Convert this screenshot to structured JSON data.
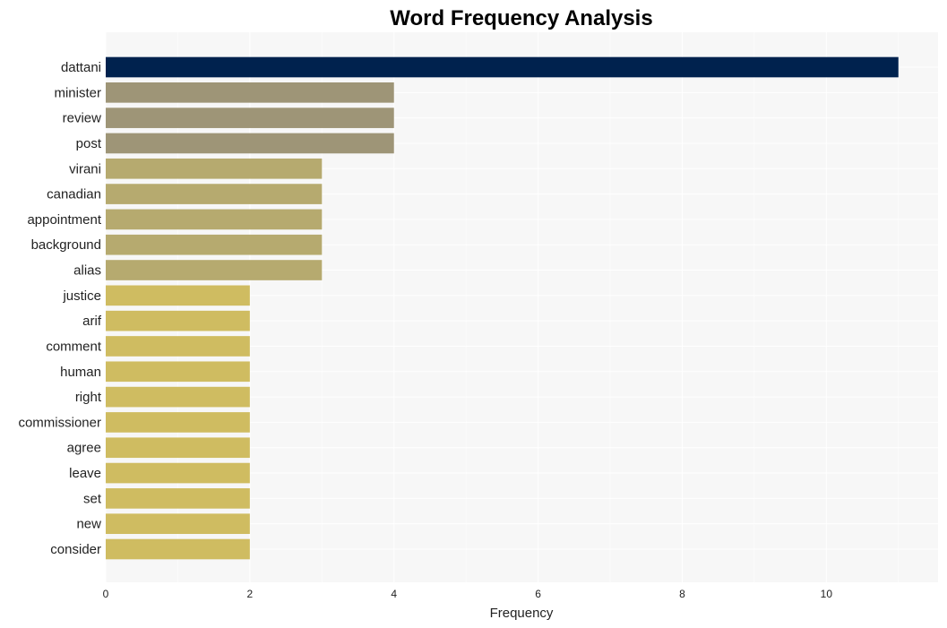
{
  "chart_data": {
    "type": "bar",
    "orientation": "horizontal",
    "title": "Word Frequency Analysis",
    "xlabel": "Frequency",
    "ylabel": "",
    "xlim": [
      0,
      11.55
    ],
    "xticks": [
      0,
      2,
      4,
      6,
      8,
      10
    ],
    "grid": true,
    "legend": "none",
    "categories": [
      "dattani",
      "minister",
      "review",
      "post",
      "virani",
      "canadian",
      "appointment",
      "background",
      "alias",
      "justice",
      "arif",
      "comment",
      "human",
      "right",
      "commissioner",
      "agree",
      "leave",
      "set",
      "new",
      "consider"
    ],
    "values": [
      11,
      4,
      4,
      4,
      3,
      3,
      3,
      3,
      3,
      2,
      2,
      2,
      2,
      2,
      2,
      2,
      2,
      2,
      2,
      2
    ],
    "colors": {
      "11": "#00224e",
      "4": "#9e9577",
      "3": "#b6aa6f",
      "2": "#cfbc61"
    },
    "plot_background": "#f7f7f7",
    "grid_color": "#ffffff"
  }
}
